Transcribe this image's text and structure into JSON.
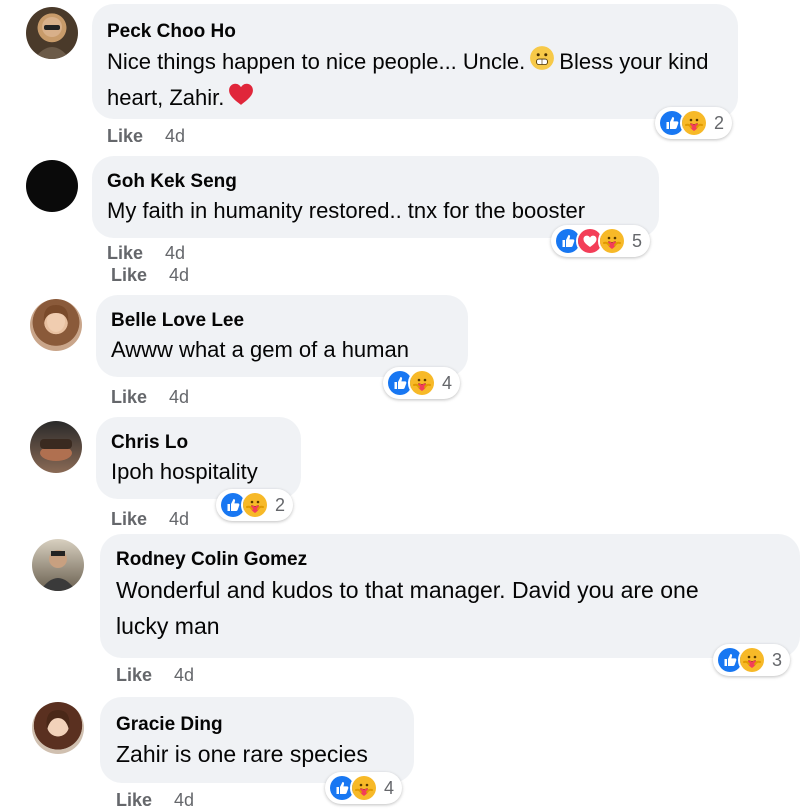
{
  "comments": [
    {
      "author": "Peck Choo Ho",
      "text_parts": [
        "Nice things happen to nice people... Uncle.",
        "Bless your kind heart, Zahir."
      ],
      "like_label": "Like",
      "time": "4d",
      "reaction_count": "2",
      "reactions": [
        "like-icon",
        "care-icon"
      ],
      "inline_emojis": [
        "grimacing-face-icon",
        "red-heart-icon"
      ]
    },
    {
      "author": "Goh Kek Seng",
      "text": "My faith in humanity restored.. tnx for the booster",
      "like_label": "Like",
      "time": "4d",
      "like_label_2": "Like",
      "time_2": "4d",
      "reaction_count": "5",
      "reactions": [
        "like-icon",
        "love-icon",
        "care-icon"
      ]
    },
    {
      "author": "Belle Love Lee",
      "text": "Awww what a gem of a human",
      "like_label": "Like",
      "time": "4d",
      "reaction_count": "4",
      "reactions": [
        "like-icon",
        "care-icon"
      ]
    },
    {
      "author": "Chris Lo",
      "text": "Ipoh hospitality",
      "like_label": "Like",
      "time": "4d",
      "reaction_count": "2",
      "reactions": [
        "like-icon",
        "care-icon"
      ]
    },
    {
      "author": "Rodney Colin Gomez",
      "text": "Wonderful and kudos to that manager. David you are one lucky man",
      "like_label": "Like",
      "time": "4d",
      "reaction_count": "3",
      "reactions": [
        "like-icon",
        "care-icon"
      ]
    },
    {
      "author": "Gracie Ding",
      "text": "Zahir is one rare species",
      "like_label": "Like",
      "time": "4d",
      "reaction_count": "4",
      "reactions": [
        "like-icon",
        "care-icon"
      ]
    }
  ],
  "colors": {
    "bubble": "#f0f2f5",
    "like_blue": "#1877f2",
    "love_red": "#f33e58",
    "care_yellow": "#f7b928",
    "meta_gray": "#65676b"
  }
}
